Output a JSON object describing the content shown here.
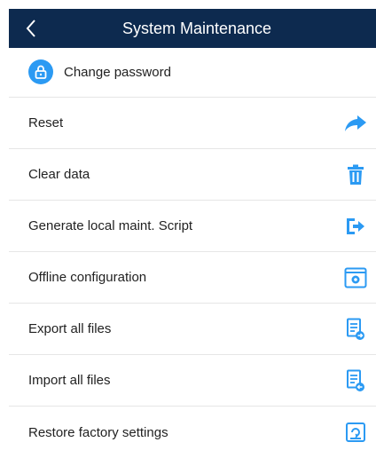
{
  "header": {
    "title": "System Maintenance",
    "back_icon": "chevron-left-icon",
    "background": "#0d2a4f"
  },
  "accent_color": "#2b9af3",
  "items": [
    {
      "label": "Change password",
      "icon": "lock-icon"
    },
    {
      "label": "Reset",
      "icon": "share-arrow-icon"
    },
    {
      "label": "Clear data",
      "icon": "trash-icon"
    },
    {
      "label": "Generate local maint. Script",
      "icon": "export-arrow-icon"
    },
    {
      "label": "Offline configuration",
      "icon": "settings-window-icon"
    },
    {
      "label": "Export all files",
      "icon": "document-export-icon"
    },
    {
      "label": "Import all files",
      "icon": "document-import-icon"
    },
    {
      "label": "Restore factory settings",
      "icon": "factory-reset-icon"
    }
  ]
}
